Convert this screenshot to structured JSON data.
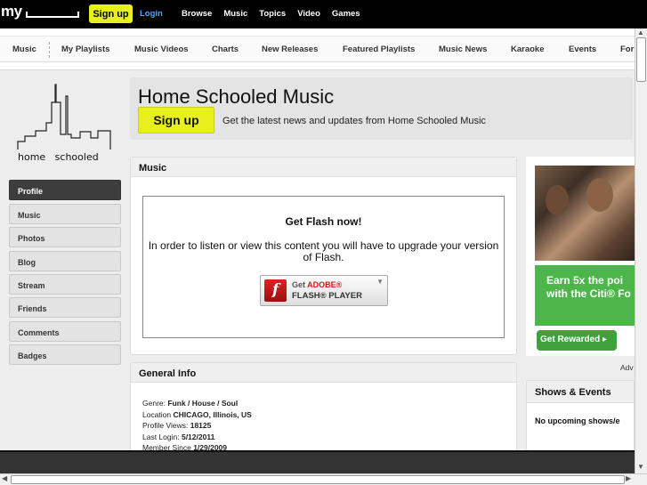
{
  "topbar": {
    "logo": "my",
    "signup": "Sign up",
    "login": "Login",
    "nav": [
      "Browse",
      "Music",
      "Topics",
      "Video",
      "Games"
    ]
  },
  "subnav": {
    "items": [
      "Music",
      "My Playlists",
      "Music Videos",
      "Charts",
      "New Releases",
      "Featured Playlists",
      "Music News",
      "Karaoke",
      "Events",
      "For"
    ]
  },
  "brand": {
    "logo_text": "home   schooled"
  },
  "sidebar": {
    "items": [
      {
        "label": "Profile",
        "active": true
      },
      {
        "label": "Music"
      },
      {
        "label": "Photos"
      },
      {
        "label": "Blog"
      },
      {
        "label": "Stream"
      },
      {
        "label": "Friends"
      },
      {
        "label": "Comments"
      },
      {
        "label": "Badges"
      }
    ]
  },
  "header": {
    "title": "Home Schooled Music",
    "signup": "Sign up",
    "description": "Get the latest news and updates from Home Schooled Music"
  },
  "music_panel": {
    "title": "Music",
    "flash_title": "Get Flash now!",
    "flash_message": "In order to listen or view this content you will have to upgrade your version of Flash.",
    "flash_button_line1_prefix": "Get ",
    "flash_button_line1_brand": "ADOBE®",
    "flash_button_line2": "FLASH® PLAYER"
  },
  "general_info": {
    "title": "General Info",
    "genre_label": "Genre:",
    "genre": "Funk / House / Soul",
    "location_label": "Location",
    "location": "CHICAGO, Illinois, US",
    "views_label": "Profile Views:",
    "views": "18125",
    "login_label": "Last Login:",
    "login": "5/12/2011",
    "since_label": "Member Since",
    "since": "1/29/2009"
  },
  "ad": {
    "headline": "Earn 5x the poi\nwith the Citi® Fo",
    "button": "Get Rewarded ▸",
    "label": "Adv"
  },
  "shows": {
    "title": "Shows & Events",
    "empty": "No upcoming shows/e"
  },
  "colors": {
    "accent_yellow": "#e8f01c",
    "ad_green": "#4db64a",
    "link_blue": "#4fa3ff"
  }
}
